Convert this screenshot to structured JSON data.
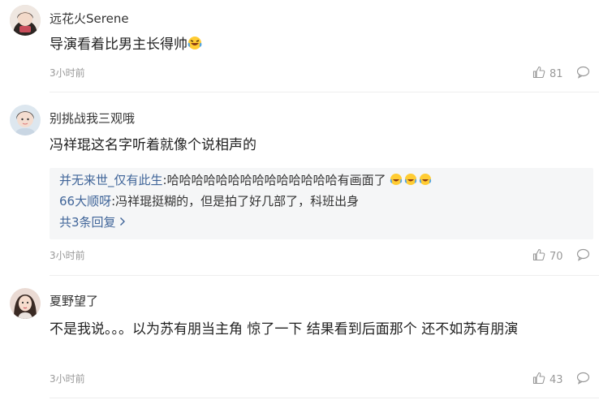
{
  "comments": [
    {
      "username": "远花火Serene",
      "text": "导演看着比男主长得帅",
      "time": "3小时前",
      "likes": "81",
      "emoji": "laughing-crying-emoji"
    },
    {
      "username": "别挑战我三观哦",
      "text": "冯祥琨这名字听着就像个说相声的",
      "replies": [
        {
          "user": "并无来世_仅有此生",
          "sep": ":",
          "text": "哈哈哈哈哈哈哈哈哈哈哈哈哈哈有画面了"
        },
        {
          "user": "66大顺呀",
          "sep": ":",
          "text": "冯祥琨挺糊的，但是拍了好几部了，科班出身"
        }
      ],
      "more_replies": "共3条回复",
      "more_icon": "chevron-right-icon",
      "time": "3小时前",
      "likes": "70"
    },
    {
      "username": "夏野望了",
      "text": "不是我说。。。以为苏有朋当主角 惊了一下 结果看到后面那个 还不如苏有朋演",
      "time": "3小时前",
      "likes": "43"
    }
  ],
  "icons": {
    "like": "thumbs-up-icon",
    "reply": "comment-bubble-icon"
  },
  "colors": {
    "link": "#406599",
    "muted": "#999999",
    "reply_bg": "#f5f6f7"
  }
}
